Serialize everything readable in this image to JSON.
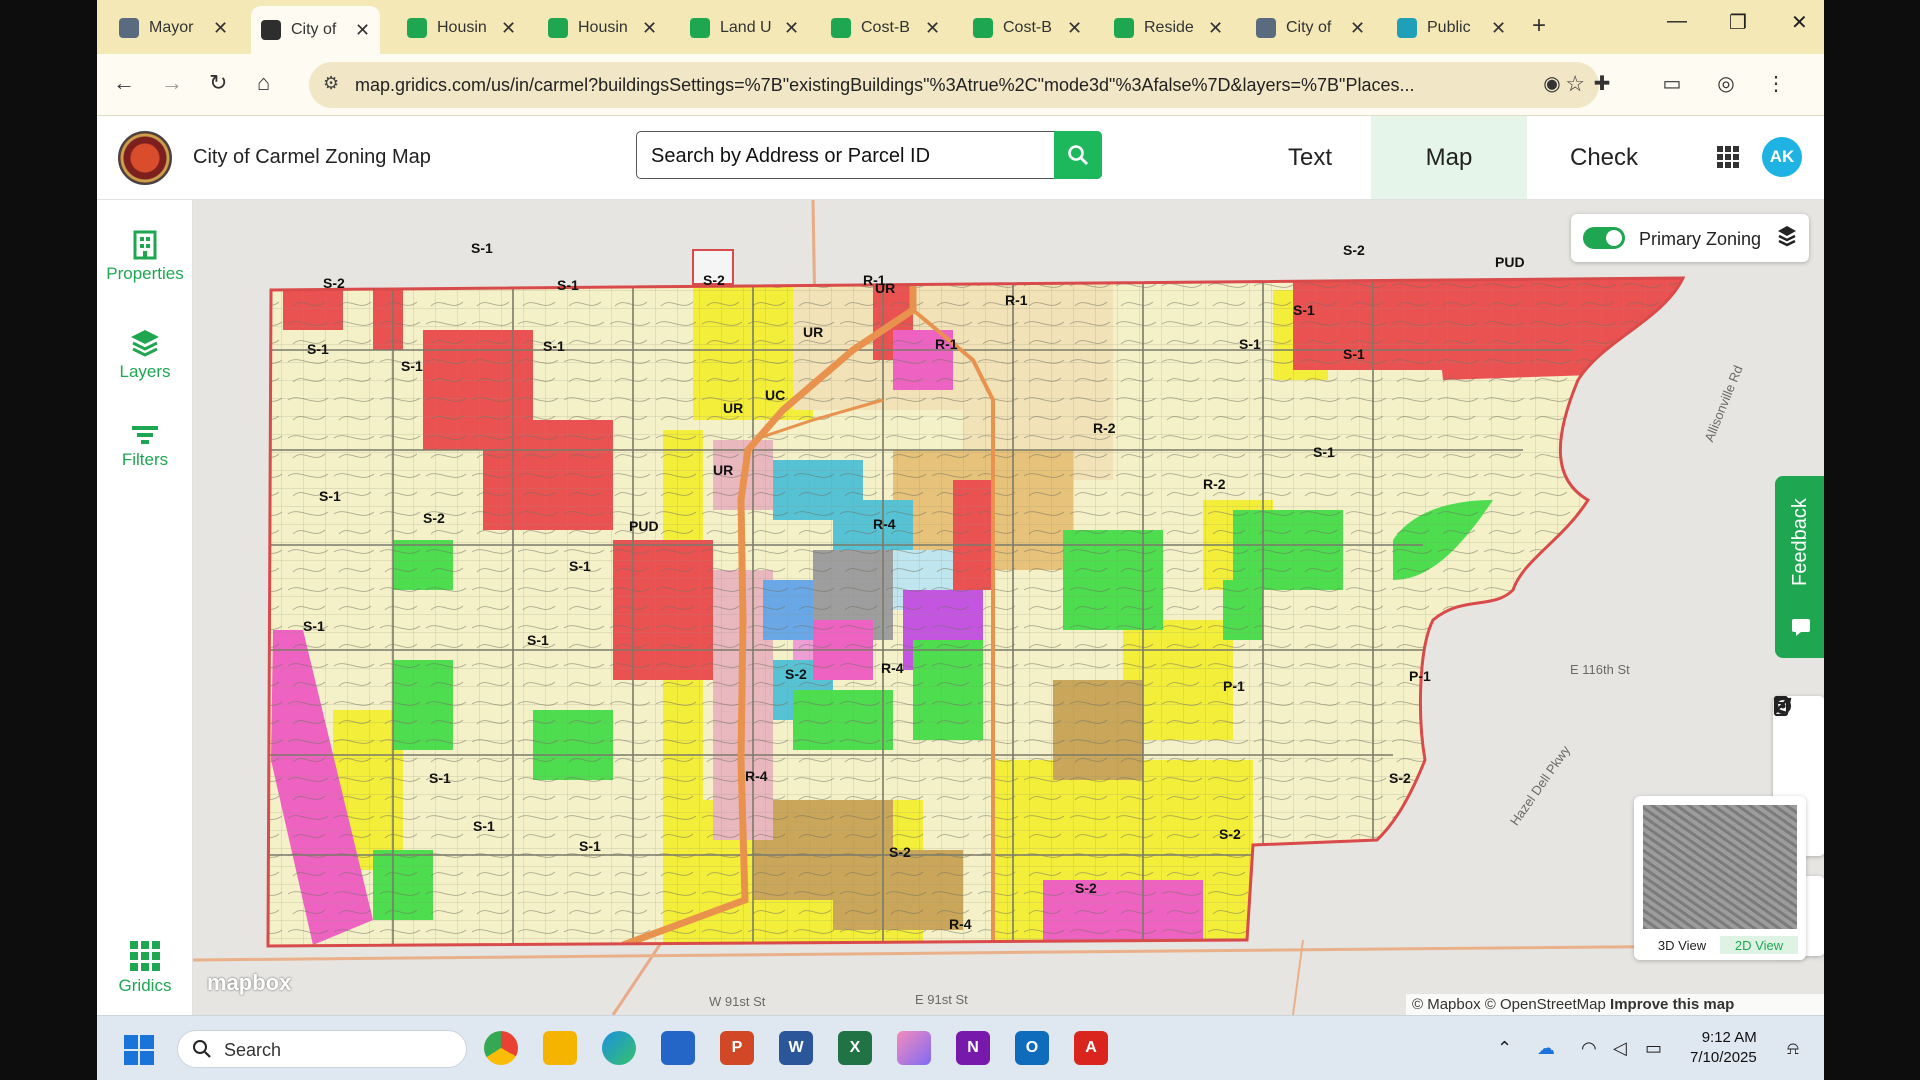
{
  "browser": {
    "tabs": [
      {
        "label": "Mayor",
        "color": "#5a6b7f"
      },
      {
        "label": "City of",
        "color": "#2e2e2e"
      },
      {
        "label": "Housin",
        "color": "#1fa651"
      },
      {
        "label": "Housin",
        "color": "#1fa651"
      },
      {
        "label": "Land U",
        "color": "#1fa651"
      },
      {
        "label": "Cost-B",
        "color": "#1fa651"
      },
      {
        "label": "Cost-B",
        "color": "#1fa651"
      },
      {
        "label": "Reside",
        "color": "#1fa651"
      },
      {
        "label": "City of",
        "color": "#5a6b7f"
      },
      {
        "label": "Public",
        "color": "#1fa0b8"
      }
    ],
    "active_tab_index": 1,
    "new_tab_label": "+",
    "url": "map.gridics.com/us/in/carmel?buildingsSettings=%7B\"existingBuildings\"%3Atrue%2C\"mode3d\"%3Afalse%7D&layers=%7B\"Places..."
  },
  "app": {
    "title": "City of Carmel Zoning Map",
    "search_placeholder": "Search by Address or Parcel ID",
    "nav": [
      {
        "label": "Text",
        "active": false
      },
      {
        "label": "Map",
        "active": true
      },
      {
        "label": "Check",
        "active": false
      }
    ],
    "avatar_initials": "AK",
    "brand_color": "#1fa651"
  },
  "sidebar": {
    "items": [
      {
        "label": "Properties",
        "icon": "building-icon"
      },
      {
        "label": "Layers",
        "icon": "layers-icon"
      },
      {
        "label": "Filters",
        "icon": "filter-icon"
      }
    ],
    "footer_label": "Gridics"
  },
  "map": {
    "layer_toggle_label": "Primary Zoning",
    "layer_toggle_on": true,
    "feedback_label": "Feedback",
    "view_buttons": [
      {
        "label": "3D View",
        "active": false
      },
      {
        "label": "2D View",
        "active": true
      }
    ],
    "mapbox_logo": "mapbox",
    "attribution": {
      "text": "© Mapbox © OpenStreetMap",
      "improve": "Improve this map"
    },
    "street_labels": [
      "W 91st St",
      "E 91st St",
      "E 116th St",
      "Allisonville Rd",
      "Hazel Dell Pkwy"
    ],
    "zone_labels": [
      "S-1",
      "S-2",
      "R-1",
      "R-2",
      "R-4",
      "PUD",
      "UC",
      "UR",
      "P-1"
    ],
    "zone_colors": {
      "S-1": "#f4f1c9",
      "S-2": "#f3ee3a",
      "R-1": "#f1e2b7",
      "R-2": "#e7c27a",
      "R-4": "#c9a65a",
      "PUD": "#ea5252",
      "UC": "#e9b8bf",
      "UR": "#56c2d3",
      "P-1": "#4ddd4f",
      "B": "#c455e0",
      "C": "#ee63c2"
    }
  },
  "taskbar": {
    "search_label": "Search",
    "apps": [
      "Chrome",
      "File Explorer",
      "Edge",
      "Store",
      "PowerPoint",
      "Word",
      "Excel",
      "Clipchamp",
      "OneNote",
      "Outlook",
      "Acrobat"
    ],
    "time": "9:12 AM",
    "date": "7/10/2025"
  }
}
